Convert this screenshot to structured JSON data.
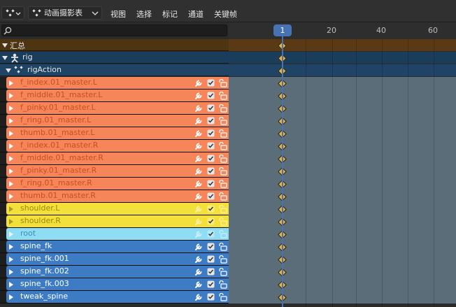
{
  "header": {
    "mode_label": "动画摄影表",
    "menu": [
      "视图",
      "选择",
      "标记",
      "通道",
      "关键帧"
    ]
  },
  "search": {
    "placeholder": ""
  },
  "timeline": {
    "current_frame": "1",
    "ticks": [
      "20",
      "40",
      "60"
    ]
  },
  "rows": [
    {
      "label": "汇总",
      "kind": "summary"
    },
    {
      "label": "rig",
      "kind": "object"
    },
    {
      "label": "rigAction",
      "kind": "action"
    },
    {
      "label": "f_index.01_master.L",
      "kind": "group",
      "color": "orange"
    },
    {
      "label": "f_middle.01_master.L",
      "kind": "group",
      "color": "orange"
    },
    {
      "label": "f_pinky.01_master.L",
      "kind": "group",
      "color": "orange"
    },
    {
      "label": "f_ring.01_master.L",
      "kind": "group",
      "color": "orange"
    },
    {
      "label": "thumb.01_master.L",
      "kind": "group",
      "color": "orange"
    },
    {
      "label": "f_index.01_master.R",
      "kind": "group",
      "color": "orange"
    },
    {
      "label": "f_middle.01_master.R",
      "kind": "group",
      "color": "orange"
    },
    {
      "label": "f_pinky.01_master.R",
      "kind": "group",
      "color": "orange"
    },
    {
      "label": "f_ring.01_master.R",
      "kind": "group",
      "color": "orange"
    },
    {
      "label": "thumb.01_master.R",
      "kind": "group",
      "color": "orange"
    },
    {
      "label": "shoulder.L",
      "kind": "group",
      "color": "yellow"
    },
    {
      "label": "shoulder.R",
      "kind": "group",
      "color": "yellow"
    },
    {
      "label": "root",
      "kind": "group",
      "color": "lightblue"
    },
    {
      "label": "spine_fk",
      "kind": "group",
      "color": "blue"
    },
    {
      "label": "spine_fk.001",
      "kind": "group",
      "color": "blue"
    },
    {
      "label": "spine_fk.002",
      "kind": "group",
      "color": "blue"
    },
    {
      "label": "spine_fk.003",
      "kind": "group",
      "color": "blue"
    },
    {
      "label": "tweak_spine",
      "kind": "group",
      "color": "blue"
    }
  ],
  "colors": {
    "summary_bg": "#4e3512",
    "summary_tl": "#5a3a14",
    "object_bg": "#1b3d5c",
    "action_bg": "#1f4466",
    "orange": "#f6855a",
    "orange_text": "#c8501e",
    "yellow": "#f4e03b",
    "yellow_text": "#9a8a12",
    "lightblue": "#8fdcf5",
    "lightblue_text": "#3a8fb0",
    "blue": "#3d7bc4",
    "blue_text": "#ffffff",
    "channel_tl": "#5b6d78",
    "accent": "#4772b3",
    "key": "#e3b342"
  },
  "icons": [
    "editor-type-icon",
    "mode-icon",
    "search-icon",
    "wrench-icon",
    "checkbox-icon",
    "lock-icon",
    "expand-triangle-icon",
    "armature-icon",
    "action-icon"
  ]
}
